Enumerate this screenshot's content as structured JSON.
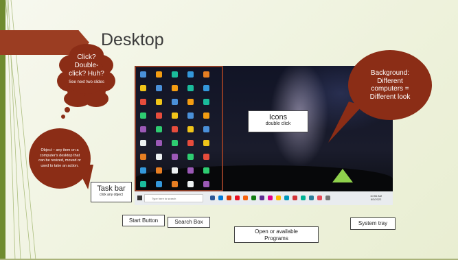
{
  "slide": {
    "title": "Desktop"
  },
  "callouts": {
    "click_cloud": {
      "main": "Click? Double-click? Huh?",
      "sub": "See next two slides"
    },
    "object_bubble": {
      "text": "Object – any item on a computer's desktop that can be resized, moved or used to take an action."
    },
    "background_bubble": {
      "text": "Background: Different computers = Different look"
    },
    "icons": {
      "title": "Icons",
      "sub": "double click"
    },
    "taskbar": {
      "title": "Task bar",
      "sub": "click any object"
    },
    "start_button": {
      "label": "Start Button"
    },
    "search_box": {
      "label": "Search Box"
    },
    "programs": {
      "label": "Open or available Programs"
    },
    "system_tray": {
      "label": "System tray"
    }
  },
  "screenshot": {
    "search_placeholder": "Type here to search",
    "clock_time": "10:56 AM",
    "clock_date": "8/3/2022"
  },
  "colors": {
    "accent": "#8b2d16",
    "title_arrow": "#9b3d22",
    "strip": "#6f8b2f"
  }
}
